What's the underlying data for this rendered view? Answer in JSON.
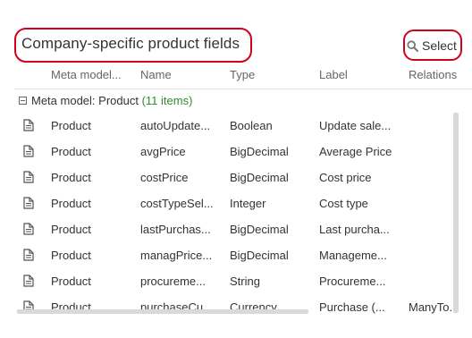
{
  "panel": {
    "title": "Company-specific product fields",
    "select_label": "Select"
  },
  "columns": [
    "Meta model...",
    "Name",
    "Type",
    "Label",
    "Relations"
  ],
  "group": {
    "label": "Meta model: Product",
    "count": "(11 items)"
  },
  "rows": [
    {
      "meta": "Product",
      "name": "autoUpdate...",
      "type": "Boolean",
      "label": "Update sale...",
      "relations": ""
    },
    {
      "meta": "Product",
      "name": "avgPrice",
      "type": "BigDecimal",
      "label": "Average Price",
      "relations": ""
    },
    {
      "meta": "Product",
      "name": "costPrice",
      "type": "BigDecimal",
      "label": "Cost price",
      "relations": ""
    },
    {
      "meta": "Product",
      "name": "costTypeSel...",
      "type": "Integer",
      "label": "Cost type",
      "relations": ""
    },
    {
      "meta": "Product",
      "name": "lastPurchas...",
      "type": "BigDecimal",
      "label": "Last purcha...",
      "relations": ""
    },
    {
      "meta": "Product",
      "name": "managPrice...",
      "type": "BigDecimal",
      "label": "Manageme...",
      "relations": ""
    },
    {
      "meta": "Product",
      "name": "procureme...",
      "type": "String",
      "label": "Procureme...",
      "relations": ""
    },
    {
      "meta": "Product",
      "name": "purchaseCu...",
      "type": "Currency",
      "label": "Purchase (...",
      "relations": "ManyTo..."
    }
  ],
  "icons": {
    "select": "search-icon",
    "row": "document-icon",
    "group_toggle": "collapse-minus-icon"
  },
  "colors": {
    "highlight": "#d0021b",
    "count": "#2e8b2e"
  }
}
